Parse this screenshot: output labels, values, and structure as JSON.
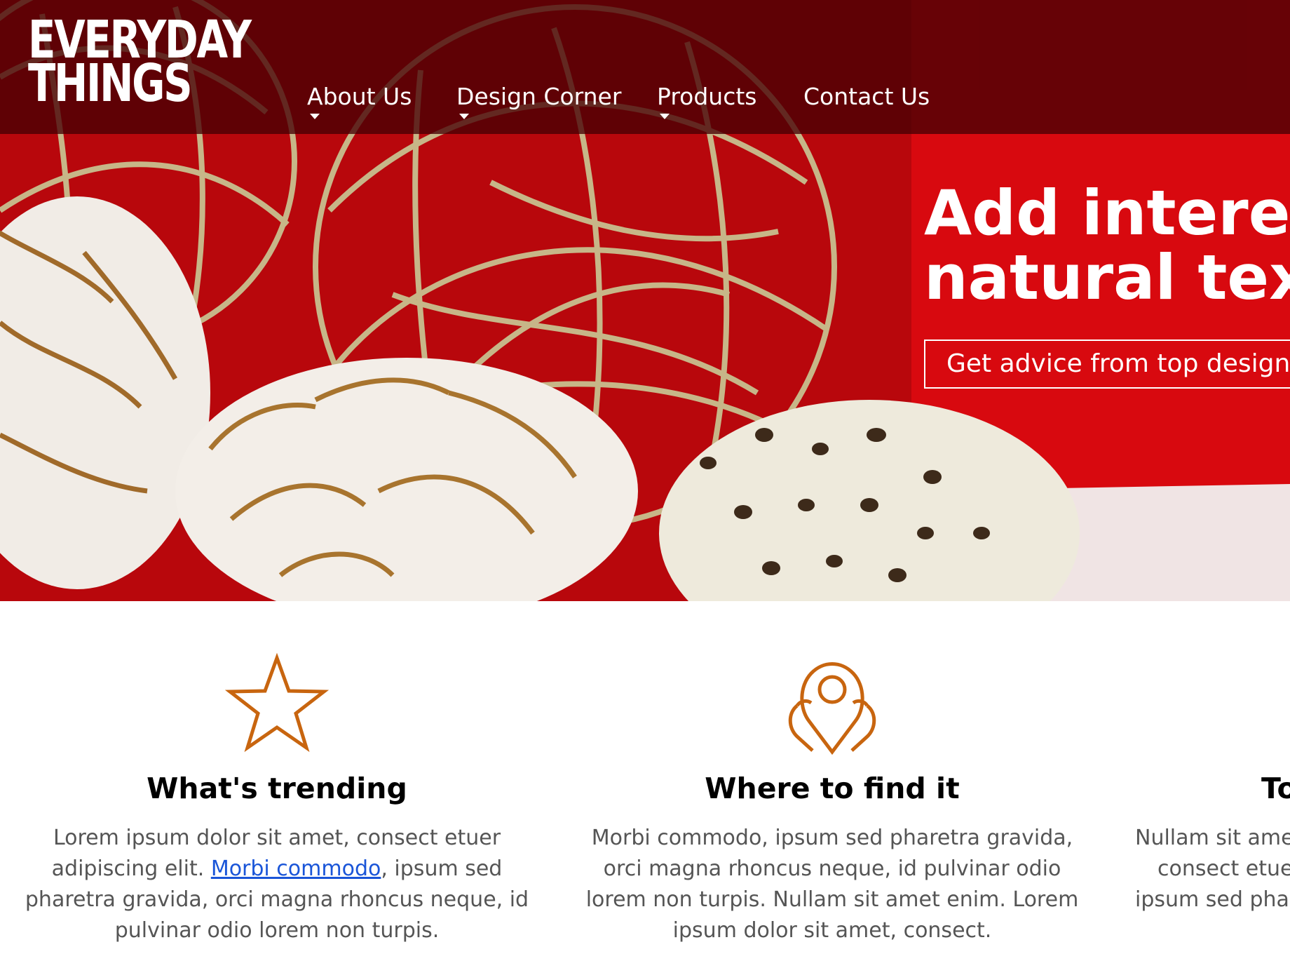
{
  "header": {
    "logo_line1": "EVERYDAY",
    "logo_line2": "THINGS",
    "nav": [
      {
        "label": "About Us",
        "has_dropdown": true
      },
      {
        "label": "Design Corner",
        "has_dropdown": true
      },
      {
        "label": "Products",
        "has_dropdown": true
      },
      {
        "label": "Contact Us",
        "has_dropdown": false
      }
    ]
  },
  "hero": {
    "headline_line1": "Add interest",
    "headline_line2": "natural text",
    "cta_label": "Get advice from top designer"
  },
  "features": [
    {
      "icon": "star-icon",
      "title": "What's trending",
      "text_before": "Lorem ipsum dolor sit amet, consect etuer adipiscing elit. ",
      "link": "Morbi commodo",
      "text_after": ", ipsum sed pharetra gravida, orci magna rhoncus neque, id pulvinar odio lorem non turpis."
    },
    {
      "icon": "map-pin-icon",
      "title": "Where to find it",
      "text": "Morbi commodo, ipsum sed pharetra gravida, orci magna rhoncus neque, id pulvinar odio lorem non turpis. Nullam sit amet enim. Lorem ipsum dolor sit amet, consect."
    },
    {
      "title": "To",
      "line1": "Nullam sit amet",
      "line2": "consect etuer",
      "line3": "ipsum sed phare"
    }
  ],
  "colors": {
    "topbar": "#46000400",
    "hero_bg": "#d40a0f",
    "icon_orange": "#c8650f",
    "link_blue": "#1a55d8"
  }
}
